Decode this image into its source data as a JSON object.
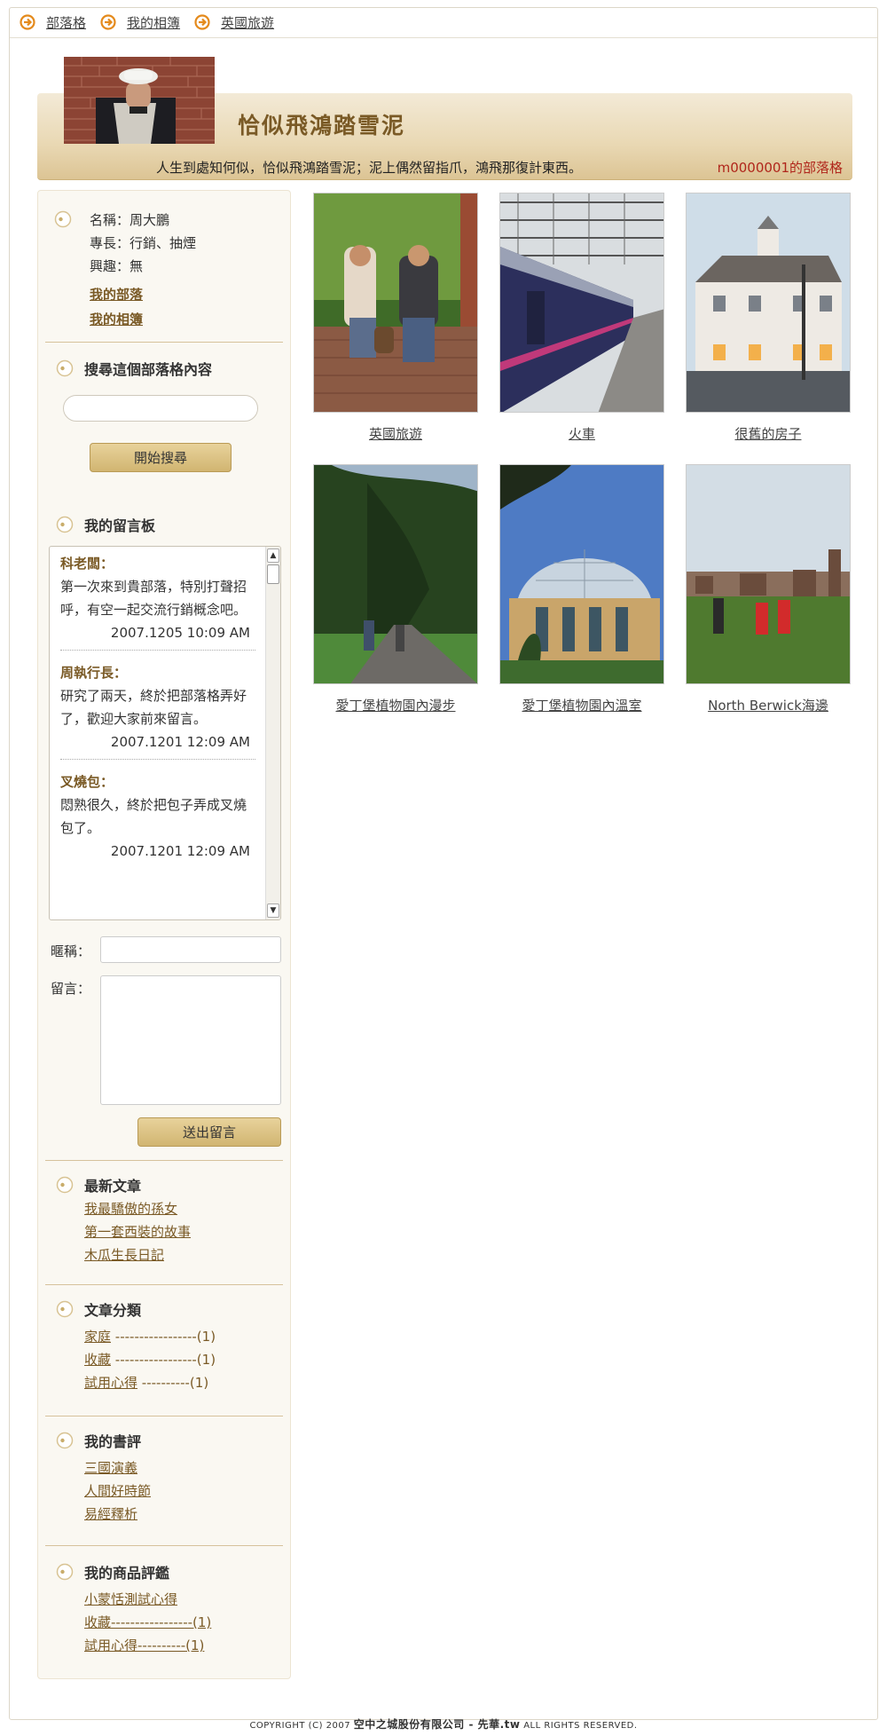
{
  "nav": {
    "items": [
      {
        "label": "部落格"
      },
      {
        "label": "我的相簿"
      },
      {
        "label": "英國旅遊"
      }
    ]
  },
  "header": {
    "title": "恰似飛鴻踏雪泥",
    "motto": "人生到處知何似，恰似飛鴻踏雪泥；泥上偶然留指爪，鴻飛那復計東西。",
    "owner": "m0000001的部落格"
  },
  "profile": {
    "name": "名稱：周大鵬",
    "specialty": "專長：行銷、抽煙",
    "hobby": "興趣：無",
    "link_blog": "我的部落",
    "link_album": "我的相簿"
  },
  "search": {
    "title": "搜尋這個部落格內容",
    "button": "開始搜尋"
  },
  "guestbook": {
    "title": "我的留言板",
    "entries": [
      {
        "author": "科老闆：",
        "text": "第一次來到貴部落，特別打聲招呼，有空一起交流行銷概念吧。",
        "time": "2007.1205 10:09 AM"
      },
      {
        "author": "周執行長：",
        "text": "研究了兩天，終於把部落格弄好了，歡迎大家前來留言。",
        "time": "2007.1201 12:09 AM"
      },
      {
        "author": "叉燒包：",
        "text": "悶熟很久，終於把包子弄成叉燒包了。",
        "time": "2007.1201 12:09 AM"
      }
    ],
    "nick_label": "暱稱：",
    "msg_label": "留言：",
    "submit": "送出留言"
  },
  "latest": {
    "title": "最新文章",
    "items": [
      "我最驕傲的孫女",
      "第一套西裝的故事",
      "木瓜生長日記"
    ]
  },
  "categories": {
    "title": "文章分類",
    "items": [
      {
        "label": "家庭",
        "count": "-----------------(1)"
      },
      {
        "label": "收藏",
        "count": "-----------------(1)"
      },
      {
        "label": "試用心得",
        "count": "----------(1)"
      }
    ]
  },
  "books": {
    "title": "我的書評",
    "items": [
      "三國演義",
      "人間好時節",
      "易經釋析"
    ]
  },
  "reviews": {
    "title": "我的商品評鑑",
    "items": [
      {
        "label": "小蒙恬測試心得",
        "count": ""
      },
      {
        "label": "收藏",
        "count": "-----------------(1)"
      },
      {
        "label": "試用心得",
        "count": "----------(1)"
      }
    ]
  },
  "photos": [
    {
      "caption": "英國旅遊"
    },
    {
      "caption": "火車"
    },
    {
      "caption": "很舊的房子"
    },
    {
      "caption": "愛丁堡植物園內漫步"
    },
    {
      "caption": "愛丁堡植物園內溫室"
    },
    {
      "caption": "North Berwick海邊"
    }
  ],
  "footer": {
    "copyright": "COPYRIGHT (C) 2007",
    "company": "空中之城股份有限公司 - 先華.tw",
    "rights": "ALL RIGHTS RESERVED."
  },
  "colors": {
    "accent": "#7a5a26",
    "owner_red": "#b0261b",
    "nav_arrow": "#e48a1c",
    "button_gold": "#d9c184"
  }
}
